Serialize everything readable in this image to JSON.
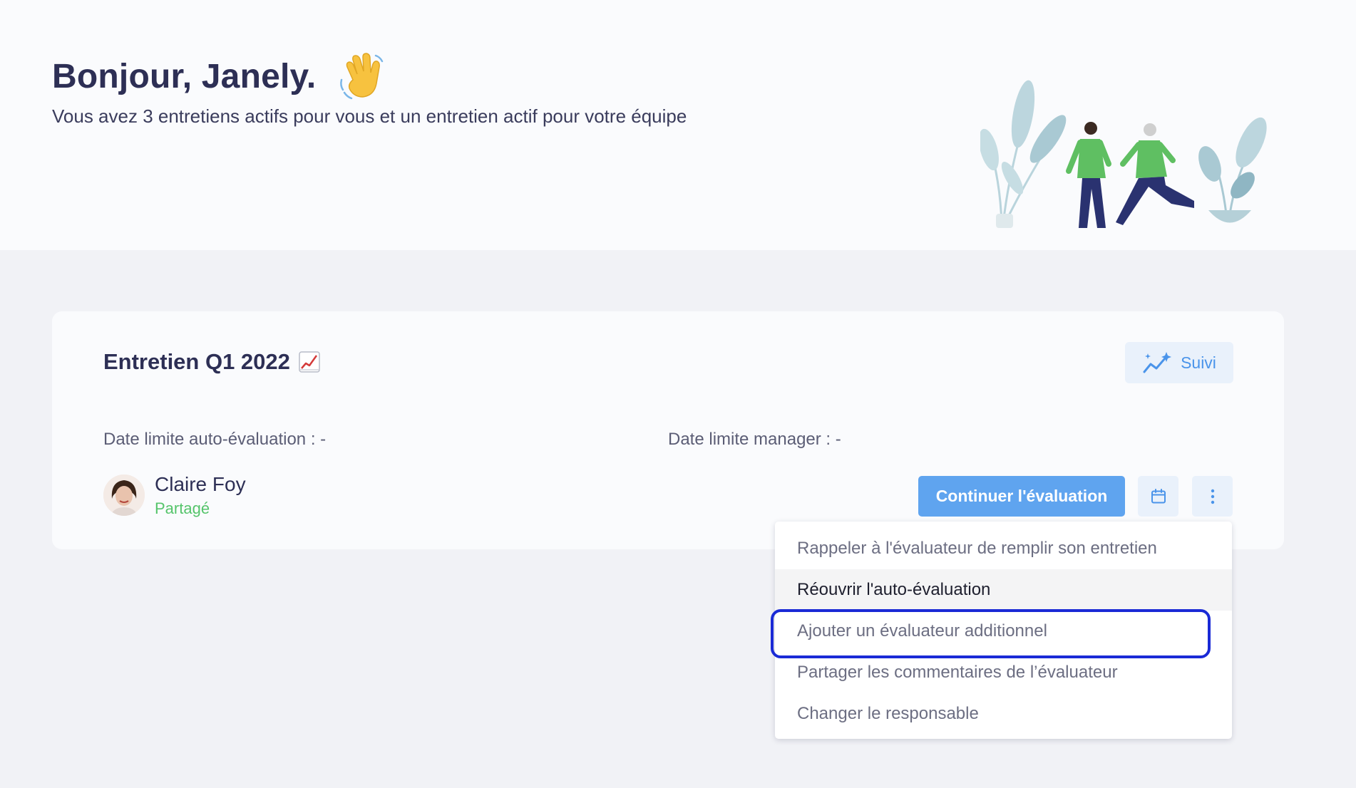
{
  "header": {
    "greeting": "Bonjour, Janely.",
    "subtitle": "Vous avez 3 entretiens actifs pour vous et un entretien actif pour votre équipe"
  },
  "review": {
    "title": "Entretien Q1 2022",
    "follow_up_label": "Suivi",
    "self_deadline": "Date limite auto-évaluation : -",
    "manager_deadline": "Date limite manager : -",
    "reviewee_name": "Claire Foy",
    "reviewee_status": "Partagé",
    "continue_label": "Continuer l'évaluation"
  },
  "menu": {
    "items": [
      {
        "label": "Rappeler à l'évaluateur de remplir son entretien"
      },
      {
        "label": "Réouvrir l'auto-évaluation"
      },
      {
        "label": "Ajouter un évaluateur additionnel"
      },
      {
        "label": "Partager les commentaires de l’évaluateur"
      },
      {
        "label": "Changer le responsable"
      }
    ],
    "hovered_index": 1,
    "highlighted_index": 2
  },
  "colors": {
    "primary": "#5fa4ef",
    "accent_text": "#4a94ea",
    "status_green": "#55c46b",
    "highlight": "#1a2ad6"
  },
  "icons": [
    "waving-hand-icon",
    "chart-increasing-icon",
    "sparkle-chart-icon",
    "calendar-icon",
    "more-vertical-icon"
  ]
}
